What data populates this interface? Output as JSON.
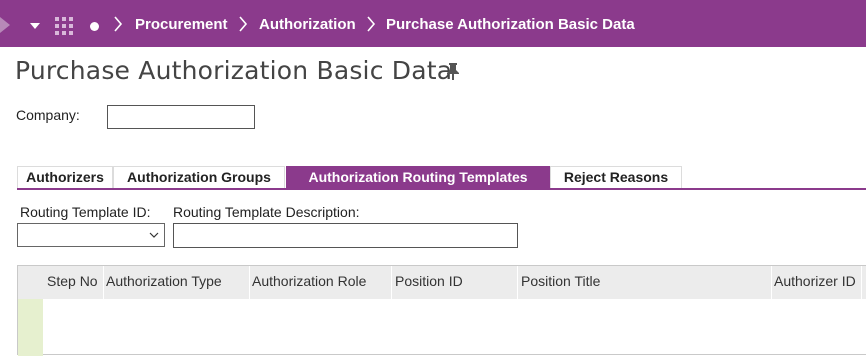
{
  "breadcrumb": {
    "items": [
      "Procurement",
      "Authorization",
      "Purchase Authorization Basic Data"
    ]
  },
  "page": {
    "title": "Purchase Authorization Basic Data"
  },
  "company": {
    "label": "Company:",
    "value": ""
  },
  "tabs": [
    {
      "label": "Authorizers",
      "active": false
    },
    {
      "label": "Authorization Groups",
      "active": false
    },
    {
      "label": "Authorization Routing Templates",
      "active": true
    },
    {
      "label": "Reject Reasons",
      "active": false
    }
  ],
  "filters": {
    "template_id_label": "Routing Template ID:",
    "template_id_value": "",
    "description_label": "Routing Template Description:",
    "description_value": ""
  },
  "table": {
    "columns": [
      "Step No",
      "Authorization Type",
      "Authorization Role",
      "Position ID",
      "Position Title",
      "Authorizer ID"
    ]
  },
  "colors": {
    "brand": "#8b3a8c",
    "header_bg": "#ececec",
    "row_marker": "#e6f0cf"
  },
  "icons": [
    "nav-arrow-icon",
    "menu-caret-icon",
    "app-grid-icon",
    "home-dot-icon",
    "chevron-right-icon",
    "pin-icon",
    "dropdown-caret-icon"
  ]
}
